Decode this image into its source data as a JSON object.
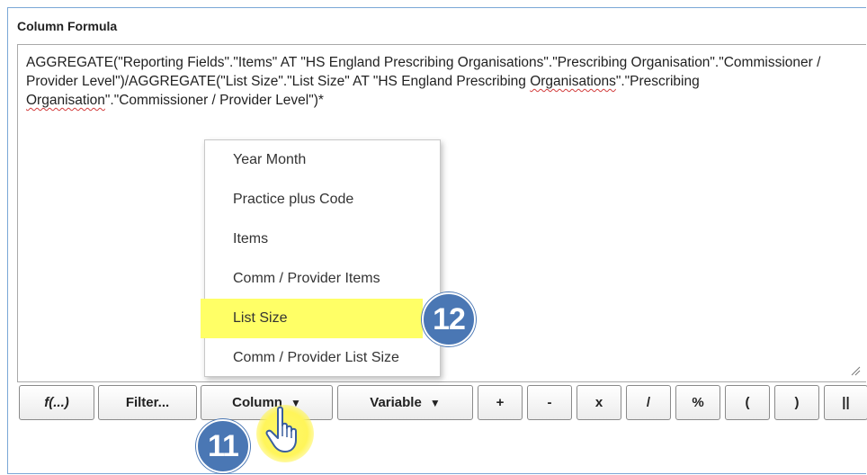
{
  "panel": {
    "title": "Column Formula"
  },
  "formula": {
    "part1": "AGGREGATE(\"Reporting Fields\".\"Items\" AT \"HS England Prescribing Organisations\".\"Prescribing Organisation\".\"Commissioner / Provider Level\")/AGGREGATE(\"List Size\".\"List Size\" AT \"HS England Prescribing ",
    "squiggle1": "Organisations",
    "part2": "\".\"Prescribing ",
    "squiggle2": "Organisation",
    "part3": "\".\"Commissioner / Provider Level\")*"
  },
  "toolbar": {
    "buttons": [
      {
        "label": "f(...)"
      },
      {
        "label": "Filter..."
      },
      {
        "label": "Column",
        "caret": "▼"
      },
      {
        "label": "Variable",
        "caret": "▼"
      },
      {
        "label": "+"
      },
      {
        "label": "-"
      },
      {
        "label": "x"
      },
      {
        "label": "/"
      },
      {
        "label": "%"
      },
      {
        "label": "("
      },
      {
        "label": ")"
      },
      {
        "label": "||"
      }
    ]
  },
  "column_menu": {
    "items": [
      {
        "label": "Year Month"
      },
      {
        "label": "Practice plus Code"
      },
      {
        "label": "Items"
      },
      {
        "label": "Comm / Provider Items"
      },
      {
        "label": "List Size",
        "highlighted": true
      },
      {
        "label": "Comm / Provider List Size"
      }
    ]
  },
  "annotations": {
    "step_12": "12",
    "step_11": "11"
  },
  "colors": {
    "highlight": "#ffff66",
    "badge": "#4a77b4",
    "border": "#7aa7d6"
  }
}
